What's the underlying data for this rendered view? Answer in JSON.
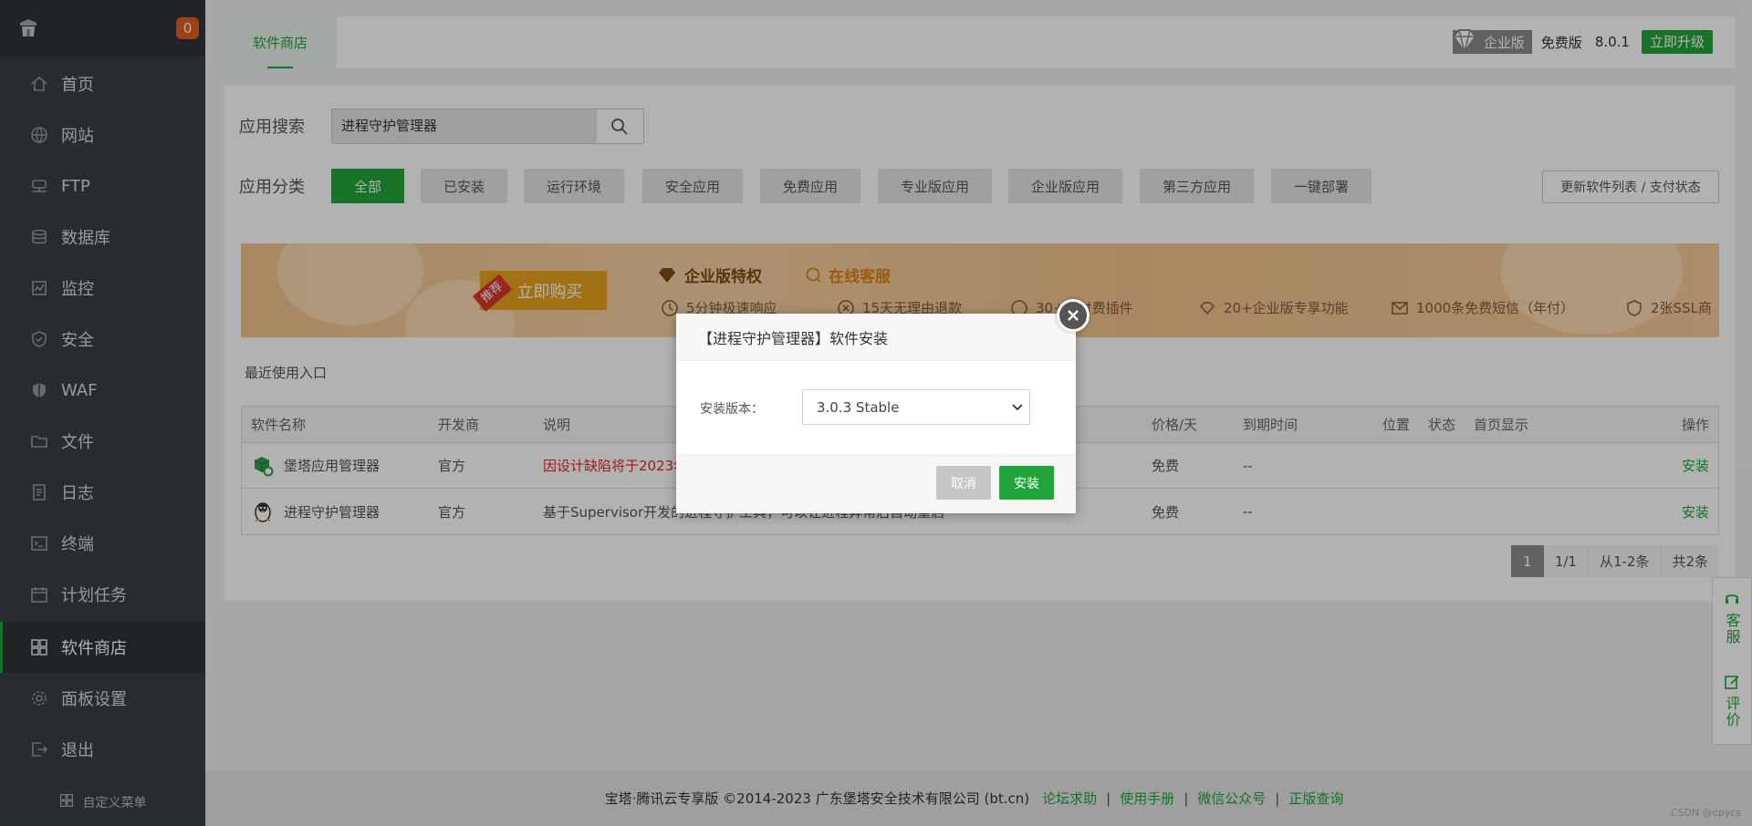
{
  "sidebar": {
    "badge": "0",
    "items": [
      {
        "label": "首页",
        "icon": "home-icon"
      },
      {
        "label": "网站",
        "icon": "globe-icon"
      },
      {
        "label": "FTP",
        "icon": "ftp-icon"
      },
      {
        "label": "数据库",
        "icon": "database-icon"
      },
      {
        "label": "监控",
        "icon": "monitor-icon"
      },
      {
        "label": "安全",
        "icon": "shield-check-icon"
      },
      {
        "label": "WAF",
        "icon": "waf-shield-icon"
      },
      {
        "label": "文件",
        "icon": "folder-icon"
      },
      {
        "label": "日志",
        "icon": "log-icon"
      },
      {
        "label": "终端",
        "icon": "terminal-icon"
      },
      {
        "label": "计划任务",
        "icon": "calendar-icon"
      },
      {
        "label": "软件商店",
        "icon": "grid-icon"
      },
      {
        "label": "面板设置",
        "icon": "gear-icon"
      },
      {
        "label": "退出",
        "icon": "logout-icon"
      }
    ],
    "active_index": 11,
    "custom_menu": "自定义菜单"
  },
  "topbar": {
    "tab": "软件商店",
    "edition": "企业版",
    "free": "免费版",
    "version": "8.0.1",
    "upgrade": "立即升级"
  },
  "search": {
    "label": "应用搜索",
    "value": "进程守护管理器"
  },
  "categories": {
    "label": "应用分类",
    "items": [
      "全部",
      "已安装",
      "运行环境",
      "安全应用",
      "免费应用",
      "专业版应用",
      "企业版应用",
      "第三方应用",
      "一键部署"
    ],
    "refresh": "更新软件列表 / 支付状态"
  },
  "banner": {
    "ribbon": "推荐",
    "buy": "立即购买",
    "title": "企业版特权",
    "service": "在线客服",
    "benefits": [
      "5分钟极速响应",
      "15天无理由退款",
      "30+款付费插件",
      "20+企业版专享功能",
      "1000条免费短信（年付）",
      "2张SSL商"
    ]
  },
  "recent": "最近使用入口",
  "table": {
    "headers": [
      "软件名称",
      "开发商",
      "说明",
      "价格/天",
      "到期时间",
      "位置",
      "状态",
      "首页显示",
      "操作"
    ],
    "rows": [
      {
        "name": "堡塔应用管理器",
        "dev": "官方",
        "desc": "因设计缺陷将于2023年",
        "price": "免费",
        "expire": "--",
        "action": "安装"
      },
      {
        "name": "进程守护管理器",
        "dev": "官方",
        "desc": "基于Supervisor开发的进程守护工具，可以让进程异常后自动重启",
        "price": "免费",
        "expire": "--",
        "action": "安装"
      }
    ]
  },
  "pager": {
    "current": "1",
    "pages": "1/1",
    "range": "从1-2条",
    "total": "共2条"
  },
  "footer": {
    "copyright": "宝塔·腾讯云专享版 ©2014-2023 广东堡塔安全技术有限公司 (bt.cn)",
    "links": [
      "论坛求助",
      "使用手册",
      "微信公众号",
      "正版查询"
    ],
    "watermark": "CSDN @cpycs"
  },
  "float": {
    "service": "客服",
    "review": "评价"
  },
  "modal": {
    "title": "【进程守护管理器】软件安装",
    "version_label": "安装版本：",
    "version_value": "3.0.3 Stable",
    "cancel": "取消",
    "install": "安装"
  }
}
